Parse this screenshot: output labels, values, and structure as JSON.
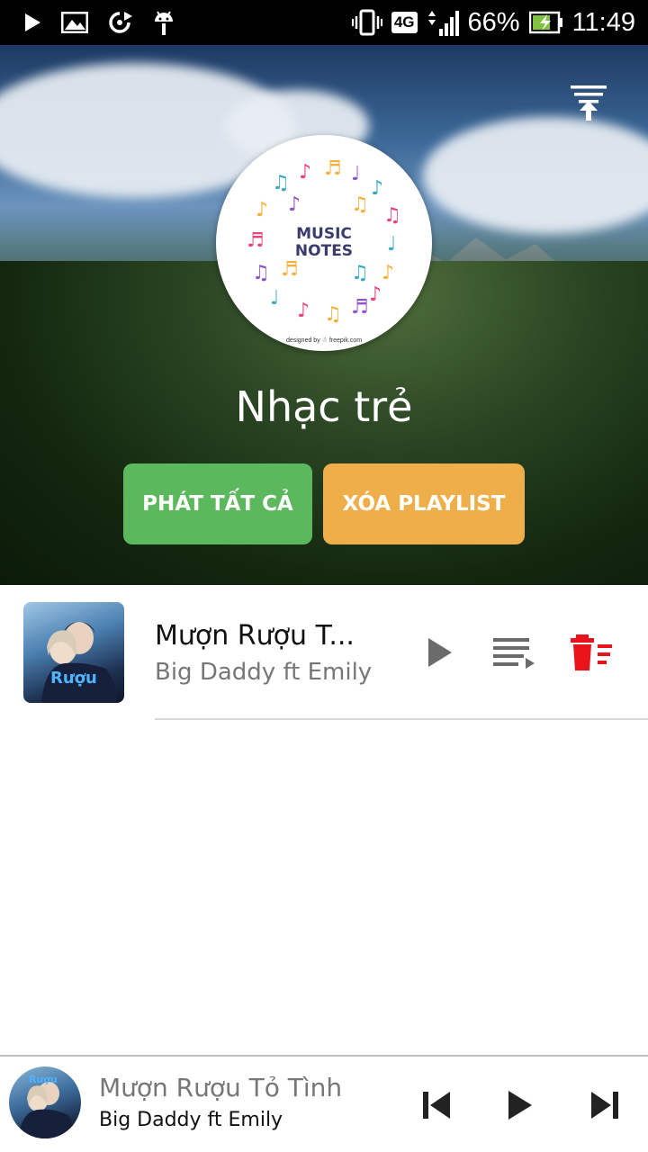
{
  "status_bar": {
    "network": "4G",
    "battery": "66%",
    "time": "11:49"
  },
  "header": {
    "cover_title_1": "MUSIC",
    "cover_title_2": "NOTES",
    "cover_credit": "designed by ☃ freepik.com",
    "playlist_name": "Nhạc trẻ",
    "play_all_label": "PHÁT TẤT CẢ",
    "delete_playlist_label": "XÓA PLAYLIST"
  },
  "songs": [
    {
      "title": "Mượn Rượu T...",
      "artist": "Big Daddy ft Emily"
    }
  ],
  "now_playing": {
    "title": "Mượn Rượu Tỏ Tình",
    "artist": "Big Daddy ft Emily"
  },
  "colors": {
    "play_all": "#5cb85c",
    "delete_playlist": "#eeae4a",
    "delete_icon": "#e8141a"
  }
}
